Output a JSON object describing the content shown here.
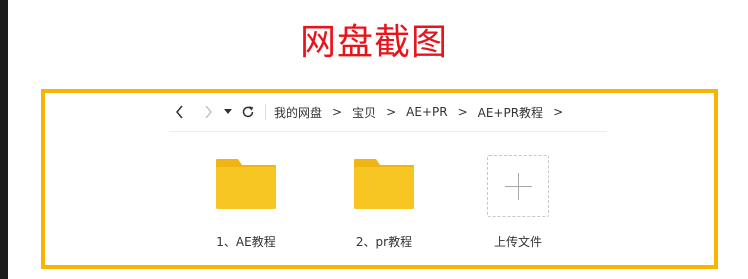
{
  "heading": "网盘截图",
  "colors": {
    "heading": "#e8141b",
    "frame_border": "#f8b400",
    "folder": "#f7c623"
  },
  "toolbar": {
    "back_icon": "chevron-left-icon",
    "forward_icon": "chevron-right-icon",
    "dropdown_icon": "caret-down-icon",
    "refresh_icon": "refresh-icon",
    "breadcrumbs": [
      "我的网盘",
      "宝贝",
      "AE+PR",
      "AE+PR教程"
    ],
    "separator": ">"
  },
  "files": [
    {
      "type": "folder",
      "name": "1、AE教程",
      "icon": "folder-icon"
    },
    {
      "type": "folder",
      "name": "2、pr教程",
      "icon": "folder-icon"
    }
  ],
  "upload": {
    "label": "上传文件",
    "icon": "plus-icon"
  }
}
